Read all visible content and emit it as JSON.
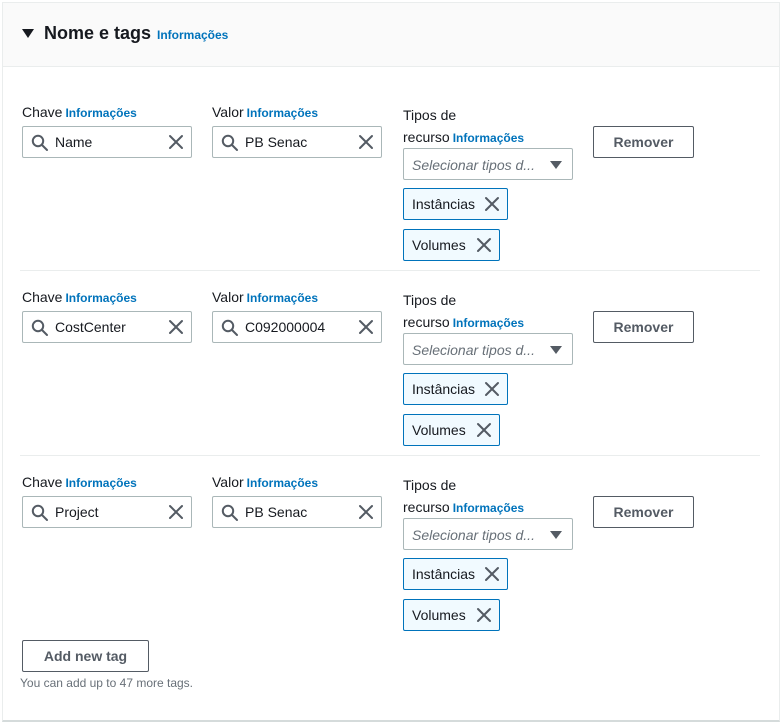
{
  "section": {
    "title": "Nome e tags",
    "info_link": "Informações"
  },
  "labels": {
    "key": "Chave",
    "value": "Valor",
    "resource_types_line1": "Tipos de",
    "resource_types_line2": "recurso",
    "info": "Informações"
  },
  "tags": [
    {
      "key": "Name",
      "value": "PB Senac",
      "resource_placeholder": "Selecionar tipos d...",
      "resource_tokens": [
        "Instâncias",
        "Volumes"
      ],
      "remove_label": "Remover"
    },
    {
      "key": "CostCenter",
      "value": "C092000004",
      "resource_placeholder": "Selecionar tipos d...",
      "resource_tokens": [
        "Instâncias",
        "Volumes"
      ],
      "remove_label": "Remover"
    },
    {
      "key": "Project",
      "value": "PB Senac",
      "resource_placeholder": "Selecionar tipos d...",
      "resource_tokens": [
        "Instâncias",
        "Volumes"
      ],
      "remove_label": "Remover"
    }
  ],
  "add_tag_button": "Add new tag",
  "hint": "You can add up to 47 more tags.",
  "colors": {
    "link": "#0073bb",
    "token_border": "#0073bb",
    "token_bg": "#f1faff",
    "text": "#16191f",
    "muted": "#687078"
  },
  "icons": {
    "collapse": "caret-down-icon",
    "search": "search-icon",
    "clear": "close-icon",
    "dropdown": "dropdown-caret-icon"
  }
}
